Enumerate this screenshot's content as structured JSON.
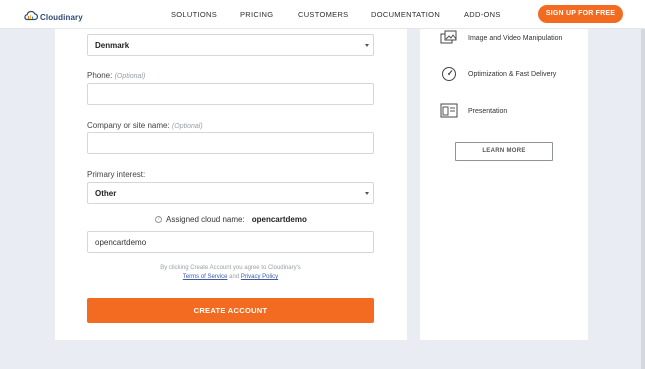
{
  "header": {
    "logo_text": "Cloudinary",
    "nav": [
      "SOLUTIONS",
      "PRICING",
      "CUSTOMERS",
      "DOCUMENTATION",
      "ADD-ONS"
    ],
    "signup_label": "SIGN UP FOR FREE"
  },
  "form": {
    "country": {
      "value": "Denmark"
    },
    "phone": {
      "label": "Phone:",
      "optional": "(Optional)",
      "value": ""
    },
    "company": {
      "label": "Company or site name:",
      "optional": "(Optional)",
      "value": ""
    },
    "interest": {
      "label": "Primary interest:",
      "value": "Other"
    },
    "cloud": {
      "label": "Assigned cloud name:",
      "name": "opencartdemo",
      "input_value": "opencartdemo"
    },
    "terms": {
      "line1": "By clicking Create Account you agree to Cloudinary's",
      "tos": "Terms of Service",
      "and": "and",
      "privacy": "Privacy Policy"
    },
    "create_label": "CREATE ACCOUNT"
  },
  "sidebar": {
    "features": [
      {
        "label": "Image and Video Manipulation",
        "icon": "image-manipulation-icon"
      },
      {
        "label": "Optimization & Fast Delivery",
        "icon": "speedometer-icon"
      },
      {
        "label": "Presentation",
        "icon": "presentation-icon"
      }
    ],
    "learn_more": "LEARN MORE"
  },
  "colors": {
    "accent": "#f26b21",
    "brand": "#2f4a73",
    "background": "#e9edf3"
  }
}
